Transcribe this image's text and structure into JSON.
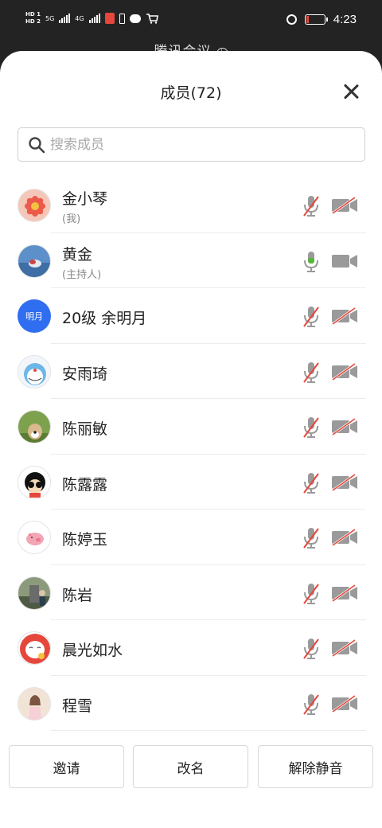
{
  "status_bar": {
    "hd1": "HD 1",
    "hd2": "HD 2",
    "net1": "5G",
    "net2": "4G",
    "time": "4:23"
  },
  "background_title": "腾讯会议",
  "sheet": {
    "title": "成员(72)",
    "search_placeholder": "搜索成员"
  },
  "members": [
    {
      "name": "金小琴",
      "role": "(我)",
      "avatar": "flower",
      "mic": "muted",
      "camera": "off"
    },
    {
      "name": "黄金",
      "role": "(主持人)",
      "avatar": "photo-blue",
      "mic": "on",
      "camera": "on"
    },
    {
      "name": "20级 余明月",
      "role": "",
      "avatar_text": "明月",
      "avatar": "text",
      "mic": "muted",
      "camera": "off"
    },
    {
      "name": "安雨琦",
      "role": "",
      "avatar": "doraemon",
      "mic": "muted",
      "camera": "off"
    },
    {
      "name": "陈丽敏",
      "role": "",
      "avatar": "dog",
      "mic": "muted",
      "camera": "off"
    },
    {
      "name": "陈露露",
      "role": "",
      "avatar": "cartoon-glasses",
      "mic": "muted",
      "camera": "off"
    },
    {
      "name": "陈婷玉",
      "role": "",
      "avatar": "pig",
      "mic": "muted",
      "camera": "off"
    },
    {
      "name": "陈岩",
      "role": "",
      "avatar": "photo-outdoor",
      "mic": "muted",
      "camera": "off"
    },
    {
      "name": "晨光如水",
      "role": "",
      "avatar": "lucky-cat",
      "mic": "muted",
      "camera": "off"
    },
    {
      "name": "程雪",
      "role": "",
      "avatar": "photo-girl",
      "mic": "muted",
      "camera": "off"
    }
  ],
  "footer": {
    "invite": "邀请",
    "rename": "改名",
    "unmute_all": "解除静音"
  },
  "colors": {
    "mute_slash": "#e5473c",
    "mic_active": "#55b63a",
    "icon_gray": "#9a9a9a",
    "avatar_blue": "#2f6ef0"
  }
}
